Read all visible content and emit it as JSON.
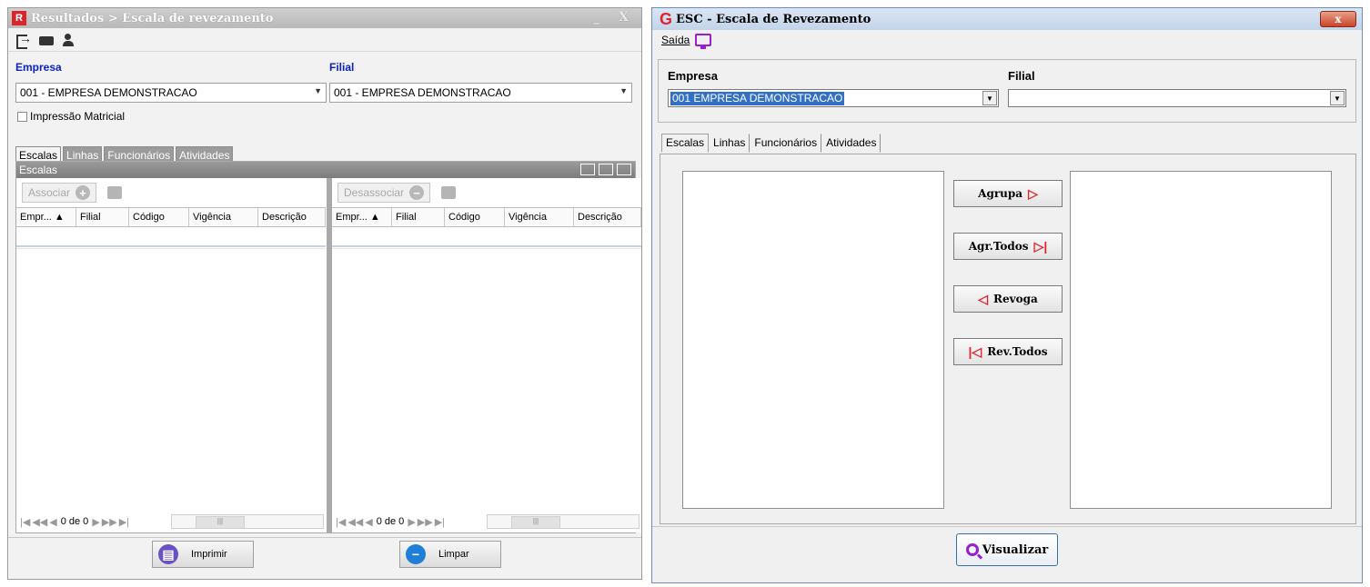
{
  "left": {
    "title": "Resultados > Escala de revezamento",
    "app_icon_glyph": "R",
    "window_controls": "_ X",
    "empresa_label": "Empresa",
    "filial_label": "Filial",
    "empresa_value": "001 - EMPRESA DEMONSTRACAO",
    "filial_value": "001 - EMPRESA DEMONSTRACAO",
    "impressao_label": "Impressão Matricial",
    "tabs": [
      "Escalas",
      "Linhas",
      "Funcionários",
      "Atividades"
    ],
    "grid_title": "Escalas",
    "associar_label": "Associar",
    "desassociar_label": "Desassociar",
    "columns": [
      "Empr... ▲",
      "Filial",
      "Código",
      "Vigência",
      "Descrição"
    ],
    "nav_count": "0 de 0",
    "imprimir_label": "Imprimir",
    "limpar_label": "Limpar"
  },
  "right": {
    "title": "ESC - Escala de Revezamento",
    "close_glyph": "x",
    "menu_saida": "Saída",
    "empresa_label": "Empresa",
    "filial_label": "Filial",
    "empresa_value": "001 EMPRESA DEMONSTRACAO",
    "filial_value": "",
    "tabs": [
      "Escalas",
      "Linhas",
      "Funcionários",
      "Atividades"
    ],
    "btn_agrupa": "Agrupa",
    "btn_agr_todos": "Agr.Todos",
    "btn_revoga": "Revoga",
    "btn_rev_todos": "Rev.Todos",
    "btn_visualizar": "Visualizar"
  },
  "colors": {
    "accent_blue": "#0b22c8",
    "brand_red": "#e0242b",
    "icon_purple": "#9a1fd0",
    "selection": "#3370c4"
  },
  "icons": [
    "exit-icon",
    "card-icon",
    "person-icon",
    "add-icon",
    "remove-icon",
    "print-icon",
    "clear-icon",
    "screen-icon",
    "magnifier-icon"
  ]
}
